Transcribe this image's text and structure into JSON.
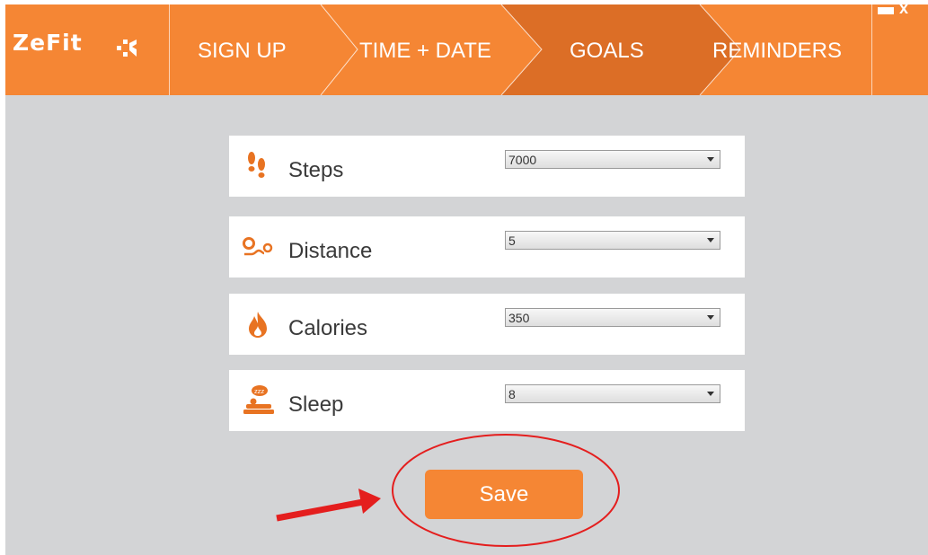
{
  "app": {
    "logo_text": "ZeFit",
    "colors": {
      "brand": "#f58634",
      "brand_dark": "#dc6e26",
      "background": "#d3d4d6",
      "annotation": "#e41e1e"
    }
  },
  "nav": {
    "steps": [
      {
        "label": "SIGN UP",
        "active": false
      },
      {
        "label": "TIME + DATE",
        "active": false
      },
      {
        "label": "GOALS",
        "active": true
      },
      {
        "label": "REMINDERS",
        "active": false
      }
    ]
  },
  "window_controls": {
    "minimize_icon": "minimize-icon",
    "close_label": "x"
  },
  "goals": [
    {
      "icon": "footprints-icon",
      "label": "Steps",
      "value": "7000"
    },
    {
      "icon": "route-icon",
      "label": "Distance",
      "value": "5"
    },
    {
      "icon": "flame-icon",
      "label": "Calories",
      "value": "350"
    },
    {
      "icon": "sleep-icon",
      "label": "Sleep",
      "value": "8"
    }
  ],
  "save_label": "Save"
}
